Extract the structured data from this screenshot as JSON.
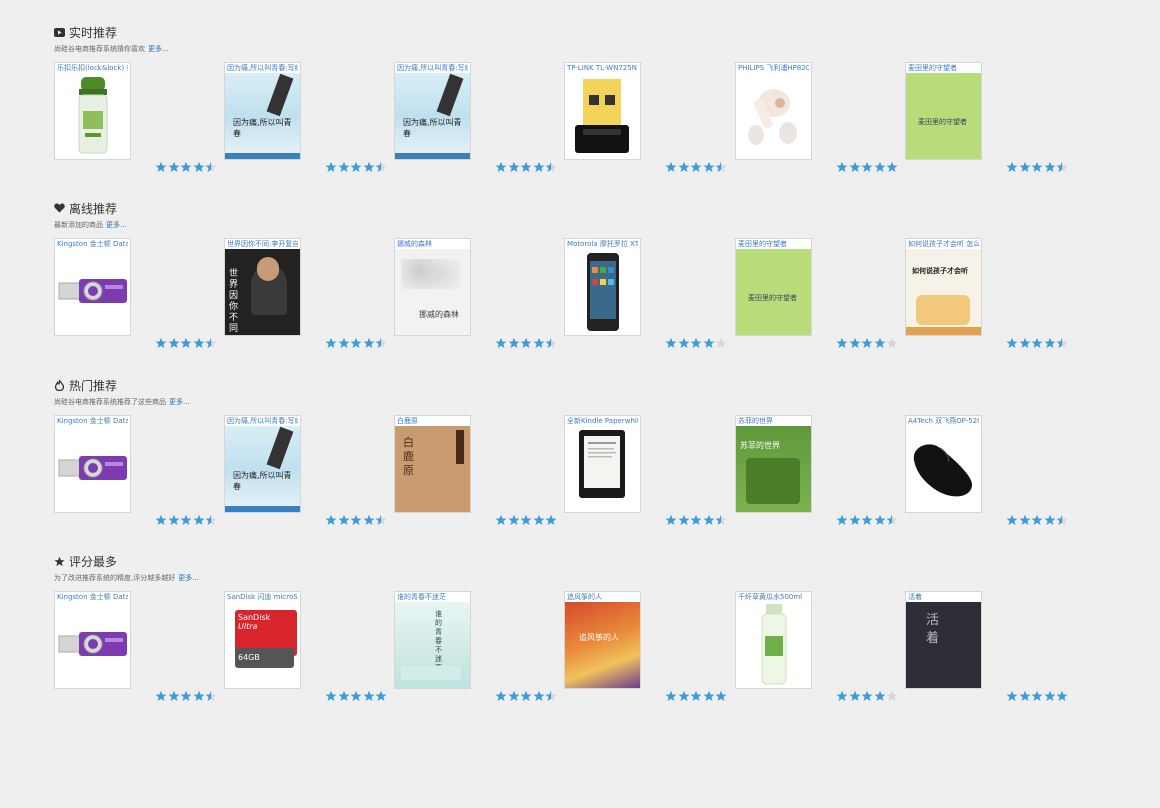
{
  "colors": {
    "star_fill": "#3d9bd6",
    "star_empty": "#d6d6d6",
    "link": "#2a6fb4",
    "title_link": "#3b7bc4"
  },
  "sections": [
    {
      "icon": "video-icon",
      "title": "实时推荐",
      "desc": "尚硅谷电商推荐系统猜你喜欢",
      "more": "更多...",
      "items": [
        {
          "name": "乐扣乐扣(lock&lock) 茶",
          "rating": 4.5,
          "cover": "bottle"
        },
        {
          "name": "因为痛,所以叫青春:写给",
          "rating": 4.5,
          "cover": "book-blue"
        },
        {
          "name": "因为痛,所以叫青春:写给",
          "rating": 4.5,
          "cover": "book-blue"
        },
        {
          "name": "TP-LINK TL-WN725N [",
          "rating": 4.5,
          "cover": "wifi"
        },
        {
          "name": "PHILIPS 飞利浦HP8203/",
          "rating": 5,
          "cover": "hairdryer"
        },
        {
          "name": "麦田里的守望者",
          "rating": 4.5,
          "cover": "book-green"
        }
      ]
    },
    {
      "icon": "heart-icon",
      "title": "离线推荐",
      "desc": "最新添加的商品",
      "more": "更多...",
      "items": [
        {
          "name": "Kingston 金士顿 DataT",
          "rating": 4.5,
          "cover": "usb"
        },
        {
          "name": "世界因你不同:李开复自传",
          "rating": 4.5,
          "cover": "book-dark"
        },
        {
          "name": "挪威的森林",
          "rating": 4.5,
          "cover": "book-gray"
        },
        {
          "name": "Motorola 摩托罗拉 XT",
          "rating": 4,
          "cover": "phone"
        },
        {
          "name": "麦田里的守望者",
          "rating": 4,
          "cover": "book-green"
        },
        {
          "name": "如何说孩子才会听 怎么",
          "rating": 4.5,
          "cover": "book-kids"
        }
      ]
    },
    {
      "icon": "fire-icon",
      "title": "热门推荐",
      "desc": "尚硅谷电商推荐系统推荐了这些商品",
      "more": "更多...",
      "items": [
        {
          "name": "Kingston 金士顿 DataT",
          "rating": 4.5,
          "cover": "usb"
        },
        {
          "name": "因为痛,所以叫青春:写给",
          "rating": 4.5,
          "cover": "book-blue"
        },
        {
          "name": "白鹿原",
          "rating": 5,
          "cover": "book-tan"
        },
        {
          "name": "全新Kindle Paperwhite",
          "rating": 4.5,
          "cover": "kindle"
        },
        {
          "name": "苏菲的世界",
          "rating": 4.5,
          "cover": "book-bookgreen"
        },
        {
          "name": "A4Tech 双飞燕OP-520",
          "rating": 4.5,
          "cover": "mouse"
        }
      ]
    },
    {
      "icon": "star-icon",
      "title": "评分最多",
      "desc": "为了改进推荐系统的精度,评分越多越好",
      "more": "更多...",
      "items": [
        {
          "name": "Kingston 金士顿 DataT",
          "rating": 4.5,
          "cover": "usb"
        },
        {
          "name": "SanDisk 闪迪 microSD",
          "rating": 5,
          "cover": "sdcard"
        },
        {
          "name": "谁的青春不迷茫",
          "rating": 4.5,
          "cover": "book-mint"
        },
        {
          "name": "追风筝的人",
          "rating": 5,
          "cover": "book-sunset"
        },
        {
          "name": "千纤草黄瓜水500ml",
          "rating": 4,
          "cover": "toner"
        },
        {
          "name": "活着",
          "rating": 5,
          "cover": "book-night"
        }
      ]
    }
  ],
  "cover_text": {
    "book_blue": "因为痛,所以叫青春",
    "book_green": "麦田里的守望者",
    "book_dark": "世界因你不同",
    "book_gray": "挪威的森林",
    "book_kids": "如何说孩子才会听",
    "book_tan": "白鹿原",
    "book_bookgreen": "苏菲的世界",
    "book_mint": "谁的青春不迷茫",
    "book_sunset": "追风筝的人",
    "book_night": "活着",
    "sd_brand": "SanDisk",
    "sd_line": "Ultra",
    "sd_size": "64GB"
  }
}
